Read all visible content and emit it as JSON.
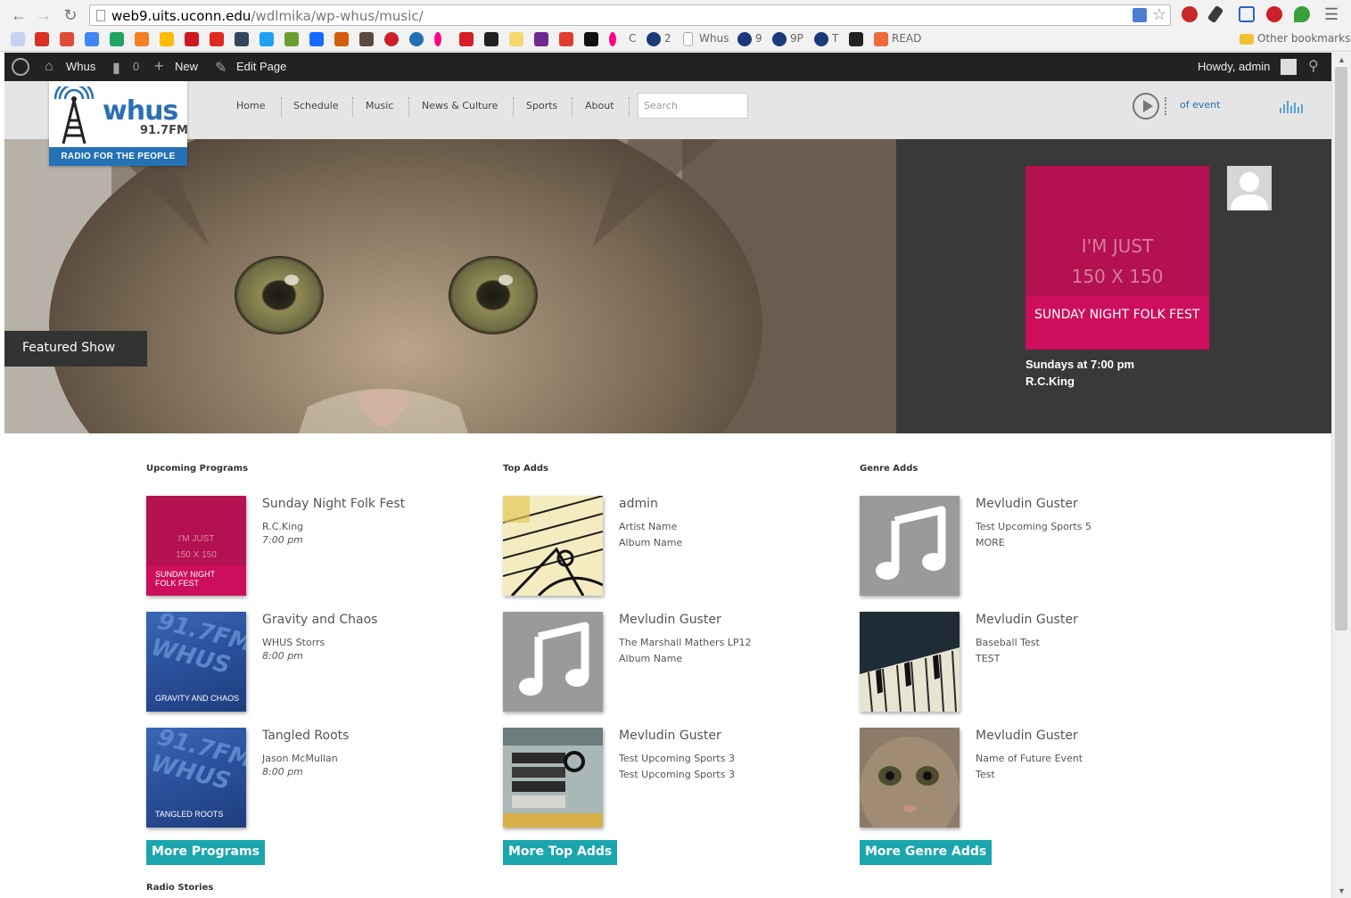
{
  "browser": {
    "url_host": "web9.uits.uconn.edu",
    "url_path": "/wdlmika/wp-whus/music/",
    "bookmarks": [
      "C",
      "2",
      "Whus",
      "9",
      "9P",
      "T",
      "READ"
    ],
    "other_bookmarks": "Other bookmarks"
  },
  "adminbar": {
    "site_name": "Whus",
    "comments_count": "0",
    "new_label": "New",
    "edit_label": "Edit Page",
    "greeting": "Howdy, admin"
  },
  "header": {
    "logo_brand": "whus",
    "logo_freq": "91.7FM",
    "logo_tagline": "RADIO FOR THE PEOPLE",
    "nav": [
      "Home",
      "Schedule",
      "Music",
      "News & Culture",
      "Sports",
      "About"
    ],
    "search_placeholder": "Search",
    "now_playing": "of event"
  },
  "hero": {
    "badge": "Featured Show",
    "placeholder_line1": "I'M JUST",
    "placeholder_line2": "150 X 150",
    "show_title": "SUNDAY NIGHT FOLK FEST",
    "show_time": "Sundays at 7:00 pm",
    "show_host": "R.C.King"
  },
  "upcoming": {
    "heading": "Upcoming Programs",
    "items": [
      {
        "title": "Sunday Night Folk Fest",
        "line1": "R.C.King",
        "line2": "7:00 pm",
        "thumb_caption": "SUNDAY NIGHT FOLK FEST",
        "thumb_ph1": "I'M JUST",
        "thumb_ph2": "150 X 150"
      },
      {
        "title": "Gravity and Chaos",
        "line1": "WHUS Storrs",
        "line2": "8:00 pm",
        "thumb_caption": "GRAVITY AND CHAOS",
        "thumb_wm": "91.7FM WHUS"
      },
      {
        "title": "Tangled Roots",
        "line1": "Jason McMullan",
        "line2": "8:00 pm",
        "thumb_caption": "TANGLED ROOTS",
        "thumb_wm": "91.7FM WHUS"
      }
    ],
    "more": "More Programs"
  },
  "topadds": {
    "heading": "Top Adds",
    "items": [
      {
        "title": "admin",
        "line1": "Artist Name",
        "line2": "Album Name"
      },
      {
        "title": "Mevludin Guster",
        "line1": "The Marshall Mathers LP12",
        "line2": "Album Name"
      },
      {
        "title": "Mevludin Guster",
        "line1": "Test Upcoming Sports 3",
        "line2": "Test Upcoming Sports 3"
      }
    ],
    "more": "More Top Adds"
  },
  "genreadds": {
    "heading": "Genre Adds",
    "items": [
      {
        "title": "Mevludin Guster",
        "line1": "Test Upcoming Sports 5",
        "line2": "MORE"
      },
      {
        "title": "Mevludin Guster",
        "line1": "Baseball Test",
        "line2": "TEST"
      },
      {
        "title": "Mevludin Guster",
        "line1": "Name of Future Event",
        "line2": "Test"
      }
    ],
    "more": "More Genre Adds"
  },
  "radio_stories": {
    "heading": "Radio Stories"
  },
  "colors": {
    "accent_teal": "#1ba6ae",
    "brand_blue": "#2471b5",
    "show_pink": "#cd0e5c"
  }
}
